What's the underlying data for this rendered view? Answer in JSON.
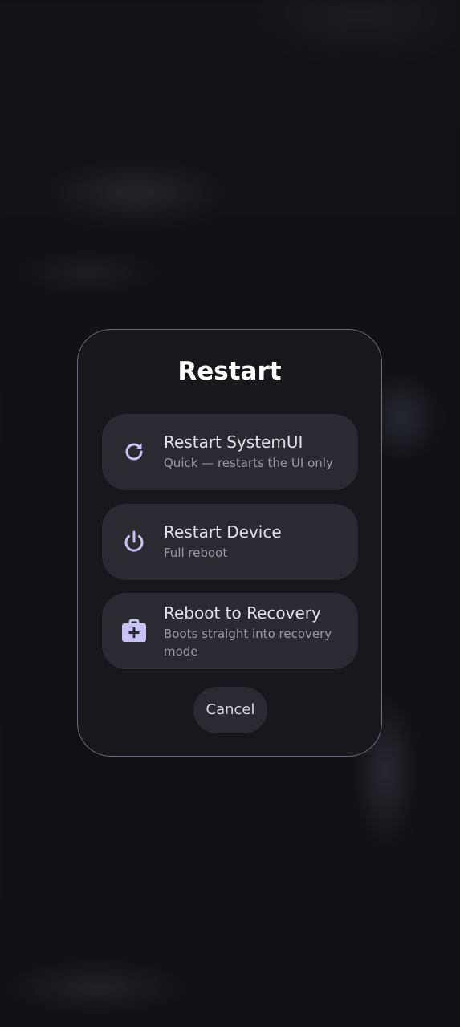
{
  "dialog": {
    "title": "Restart",
    "options": [
      {
        "icon": "refresh-icon",
        "label": "Restart SystemUI",
        "description": "Quick — restarts the UI only"
      },
      {
        "icon": "power-icon",
        "label": "Restart Device",
        "description": "Full reboot"
      },
      {
        "icon": "medical-kit-icon",
        "label": "Reboot to Recovery",
        "description": "Boots straight into recovery mode"
      }
    ],
    "cancel_label": "Cancel"
  },
  "colors": {
    "icon_accent": "#c9c3f5",
    "card": "#2b2a31",
    "dialog_bg": "#18171c",
    "dialog_border": "#6c6a78"
  }
}
